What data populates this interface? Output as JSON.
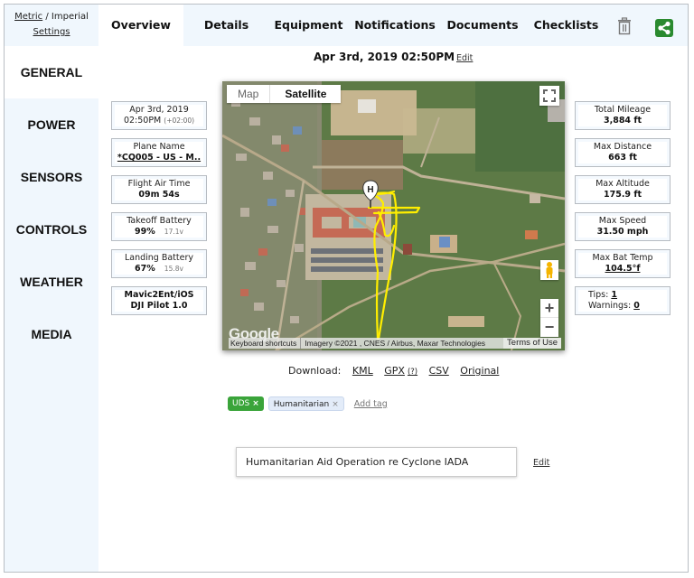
{
  "units": {
    "metric_label": "Metric",
    "separator": " / ",
    "imperial_label": "Imperial",
    "settings_label": "Settings"
  },
  "tabs": [
    {
      "label": "Overview",
      "active": true
    },
    {
      "label": "Details",
      "active": false
    },
    {
      "label": "Equipment",
      "active": false
    },
    {
      "label": "Notifications",
      "active": false
    },
    {
      "label": "Documents",
      "active": false
    },
    {
      "label": "Checklists",
      "active": false
    }
  ],
  "toolbar": {
    "delete_icon": "trash-icon",
    "share_icon": "share-icon",
    "share_color": "#2a8a2f"
  },
  "sidebar": {
    "items": [
      {
        "label": "GENERAL",
        "active": true
      },
      {
        "label": "POWER",
        "active": false
      },
      {
        "label": "SENSORS",
        "active": false
      },
      {
        "label": "CONTROLS",
        "active": false
      },
      {
        "label": "WEATHER",
        "active": false
      },
      {
        "label": "MEDIA",
        "active": false
      }
    ]
  },
  "header": {
    "datetime": "Apr 3rd, 2019 02:50PM",
    "edit_label": "Edit"
  },
  "left_cards": {
    "date": {
      "line1": "Apr 3rd, 2019",
      "time": "02:50PM",
      "tz": "(+02:00)"
    },
    "plane": {
      "label": "Plane Name",
      "value": "*CQ005 - US - M.."
    },
    "air_time": {
      "label": "Flight Air Time",
      "value": "09m 54s"
    },
    "takeoff_battery": {
      "label": "Takeoff Battery",
      "value": "99%",
      "voltage": "17.1v"
    },
    "landing_battery": {
      "label": "Landing Battery",
      "value": "67%",
      "voltage": "15.8v"
    },
    "app": {
      "line1": "Mavic2Ent/iOS",
      "line2": "DJI Pilot 1.0"
    }
  },
  "right_cards": {
    "total_mileage": {
      "label": "Total Mileage",
      "value": "3,884 ft"
    },
    "max_distance": {
      "label": "Max Distance",
      "value": "663 ft"
    },
    "max_altitude": {
      "label": "Max Altitude",
      "value": "175.9 ft"
    },
    "max_speed": {
      "label": "Max Speed",
      "value": "31.50 mph"
    },
    "max_bat_temp": {
      "label": "Max Bat Temp",
      "value": "104.5°f"
    },
    "tips": {
      "tips_label": "Tips:",
      "tips_count": "1",
      "warnings_label": "Warnings:",
      "warnings_count": "0"
    }
  },
  "map": {
    "type_map_label": "Map",
    "type_satellite_label": "Satellite",
    "selected_type": "Satellite",
    "home_marker_label": "H",
    "track_color": "#ffee00",
    "google_logo": "Google",
    "keyboard_shortcuts": "Keyboard shortcuts",
    "imagery_credit": "Imagery ©2021 , CNES / Airbus, Maxar Technologies",
    "terms": "Terms of Use",
    "zoom_in": "+",
    "zoom_out": "−"
  },
  "download": {
    "label": "Download:",
    "links": [
      "KML",
      "GPX",
      "CSV",
      "Original"
    ],
    "gpx_help": "(?)"
  },
  "tags": {
    "items": [
      {
        "label": "UDS",
        "color": "#3aa43a"
      },
      {
        "label": "Humanitarian",
        "color": "#e3ecf9"
      }
    ],
    "remove_glyph": "×",
    "add_label": "Add tag"
  },
  "notes": {
    "text": "Humanitarian Aid Operation re Cyclone IADA",
    "edit_label": "Edit"
  }
}
